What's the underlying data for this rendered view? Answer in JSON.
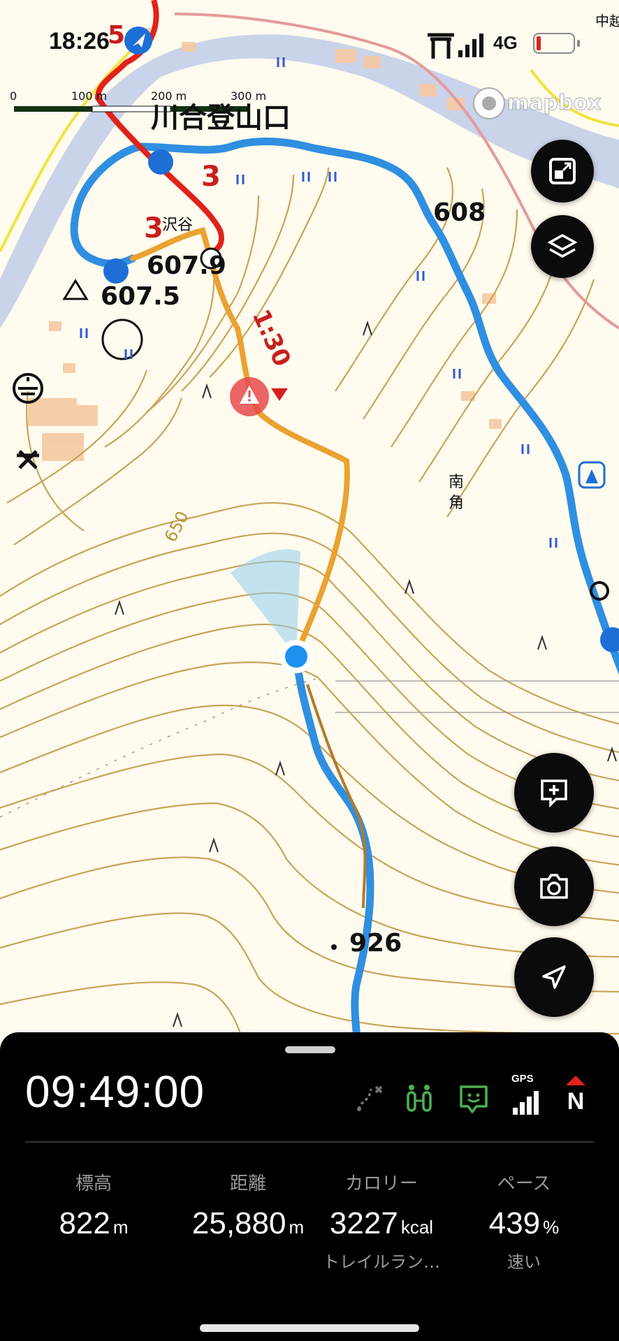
{
  "status_bar": {
    "time": "18:26",
    "network": "4G"
  },
  "map": {
    "attribution": "mapbox",
    "scale": {
      "ticks": [
        "0",
        "100 m",
        "200 m",
        "300 m"
      ]
    },
    "labels": {
      "trailhead": "川合登山口",
      "valley": "沢谷",
      "elev_608": "608",
      "elev_6079": "607.9",
      "elev_6075": "607.5",
      "contour_650": "650",
      "place_nankaku": "南角",
      "peak_926": "926",
      "corner_text": "中越",
      "route_time": "1:30",
      "route_num_5": "5",
      "route_num_3a": "3",
      "route_num_3b": "3"
    }
  },
  "controls": [
    {
      "name": "fit-route-button",
      "icon": "fit-route-icon"
    },
    {
      "name": "map-layers-button",
      "icon": "layers-icon"
    },
    {
      "name": "add-marker-button",
      "icon": "add-note-icon"
    },
    {
      "name": "camera-button",
      "icon": "camera-icon"
    },
    {
      "name": "locate-button",
      "icon": "navigation-arrow-icon"
    }
  ],
  "panel": {
    "elapsed_time": "09:49:00",
    "indicators": [
      "route-off-icon",
      "hiking-route-icon",
      "chat-icon",
      "gps-signal-icon",
      "compass-north-icon"
    ],
    "gps_label": "GPS",
    "compass_label": "N",
    "stats": [
      {
        "label": "標高",
        "value": "822",
        "unit": "m",
        "sub": ""
      },
      {
        "label": "距離",
        "value": "25,880",
        "unit": "m",
        "sub": ""
      },
      {
        "label": "カロリー",
        "value": "3227",
        "unit": "kcal",
        "sub": "トレイルラン…"
      },
      {
        "label": "ペース",
        "value": "439",
        "unit": "%",
        "sub": "速い"
      }
    ]
  },
  "colors": {
    "route_orange": "#eaa231",
    "track_blue": "#2f8fe0",
    "trail_red": "#e0221c",
    "contour": "#c8a35a",
    "river": "#aab8d8"
  }
}
